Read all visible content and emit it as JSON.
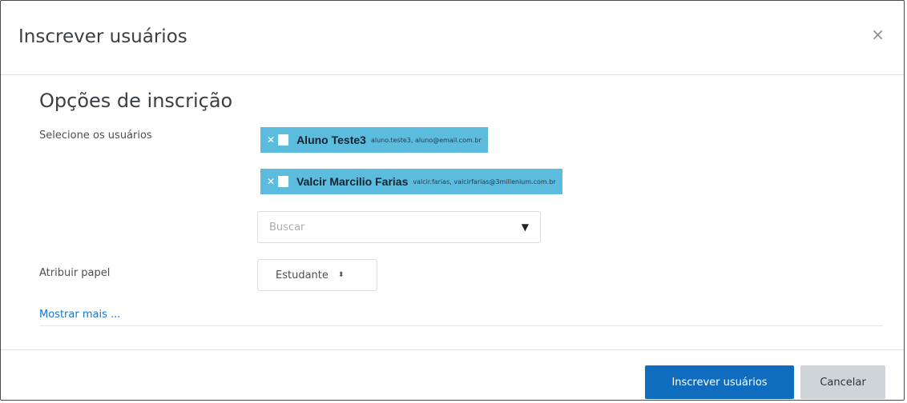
{
  "dialog": {
    "title": "Inscrever usuários",
    "close_icon": "×"
  },
  "options": {
    "section_title": "Opções de inscrição",
    "select_users_label": "Selecione os usuários",
    "selected_users": [
      {
        "name": "Aluno Teste3",
        "detail": "aluno.teste3, aluno@email.com.br"
      },
      {
        "name": "Valcir Marcilio Farias",
        "detail": "valcir.farias, valcirfarias@3millenium.com.br"
      }
    ],
    "search": {
      "placeholder": "Buscar",
      "caret": "▼"
    },
    "assign_role_label": "Atribuir papel",
    "role": {
      "value": "Estudante",
      "arrows": "⬍"
    },
    "show_more": "Mostrar mais ..."
  },
  "footer": {
    "enrol_button": "Inscrever usuários",
    "cancel_button": "Cancelar"
  },
  "colors": {
    "tag_background": "#5cbcdd",
    "primary_button": "#0f6cbf",
    "secondary_button": "#ced4da",
    "link": "#1177d1"
  }
}
